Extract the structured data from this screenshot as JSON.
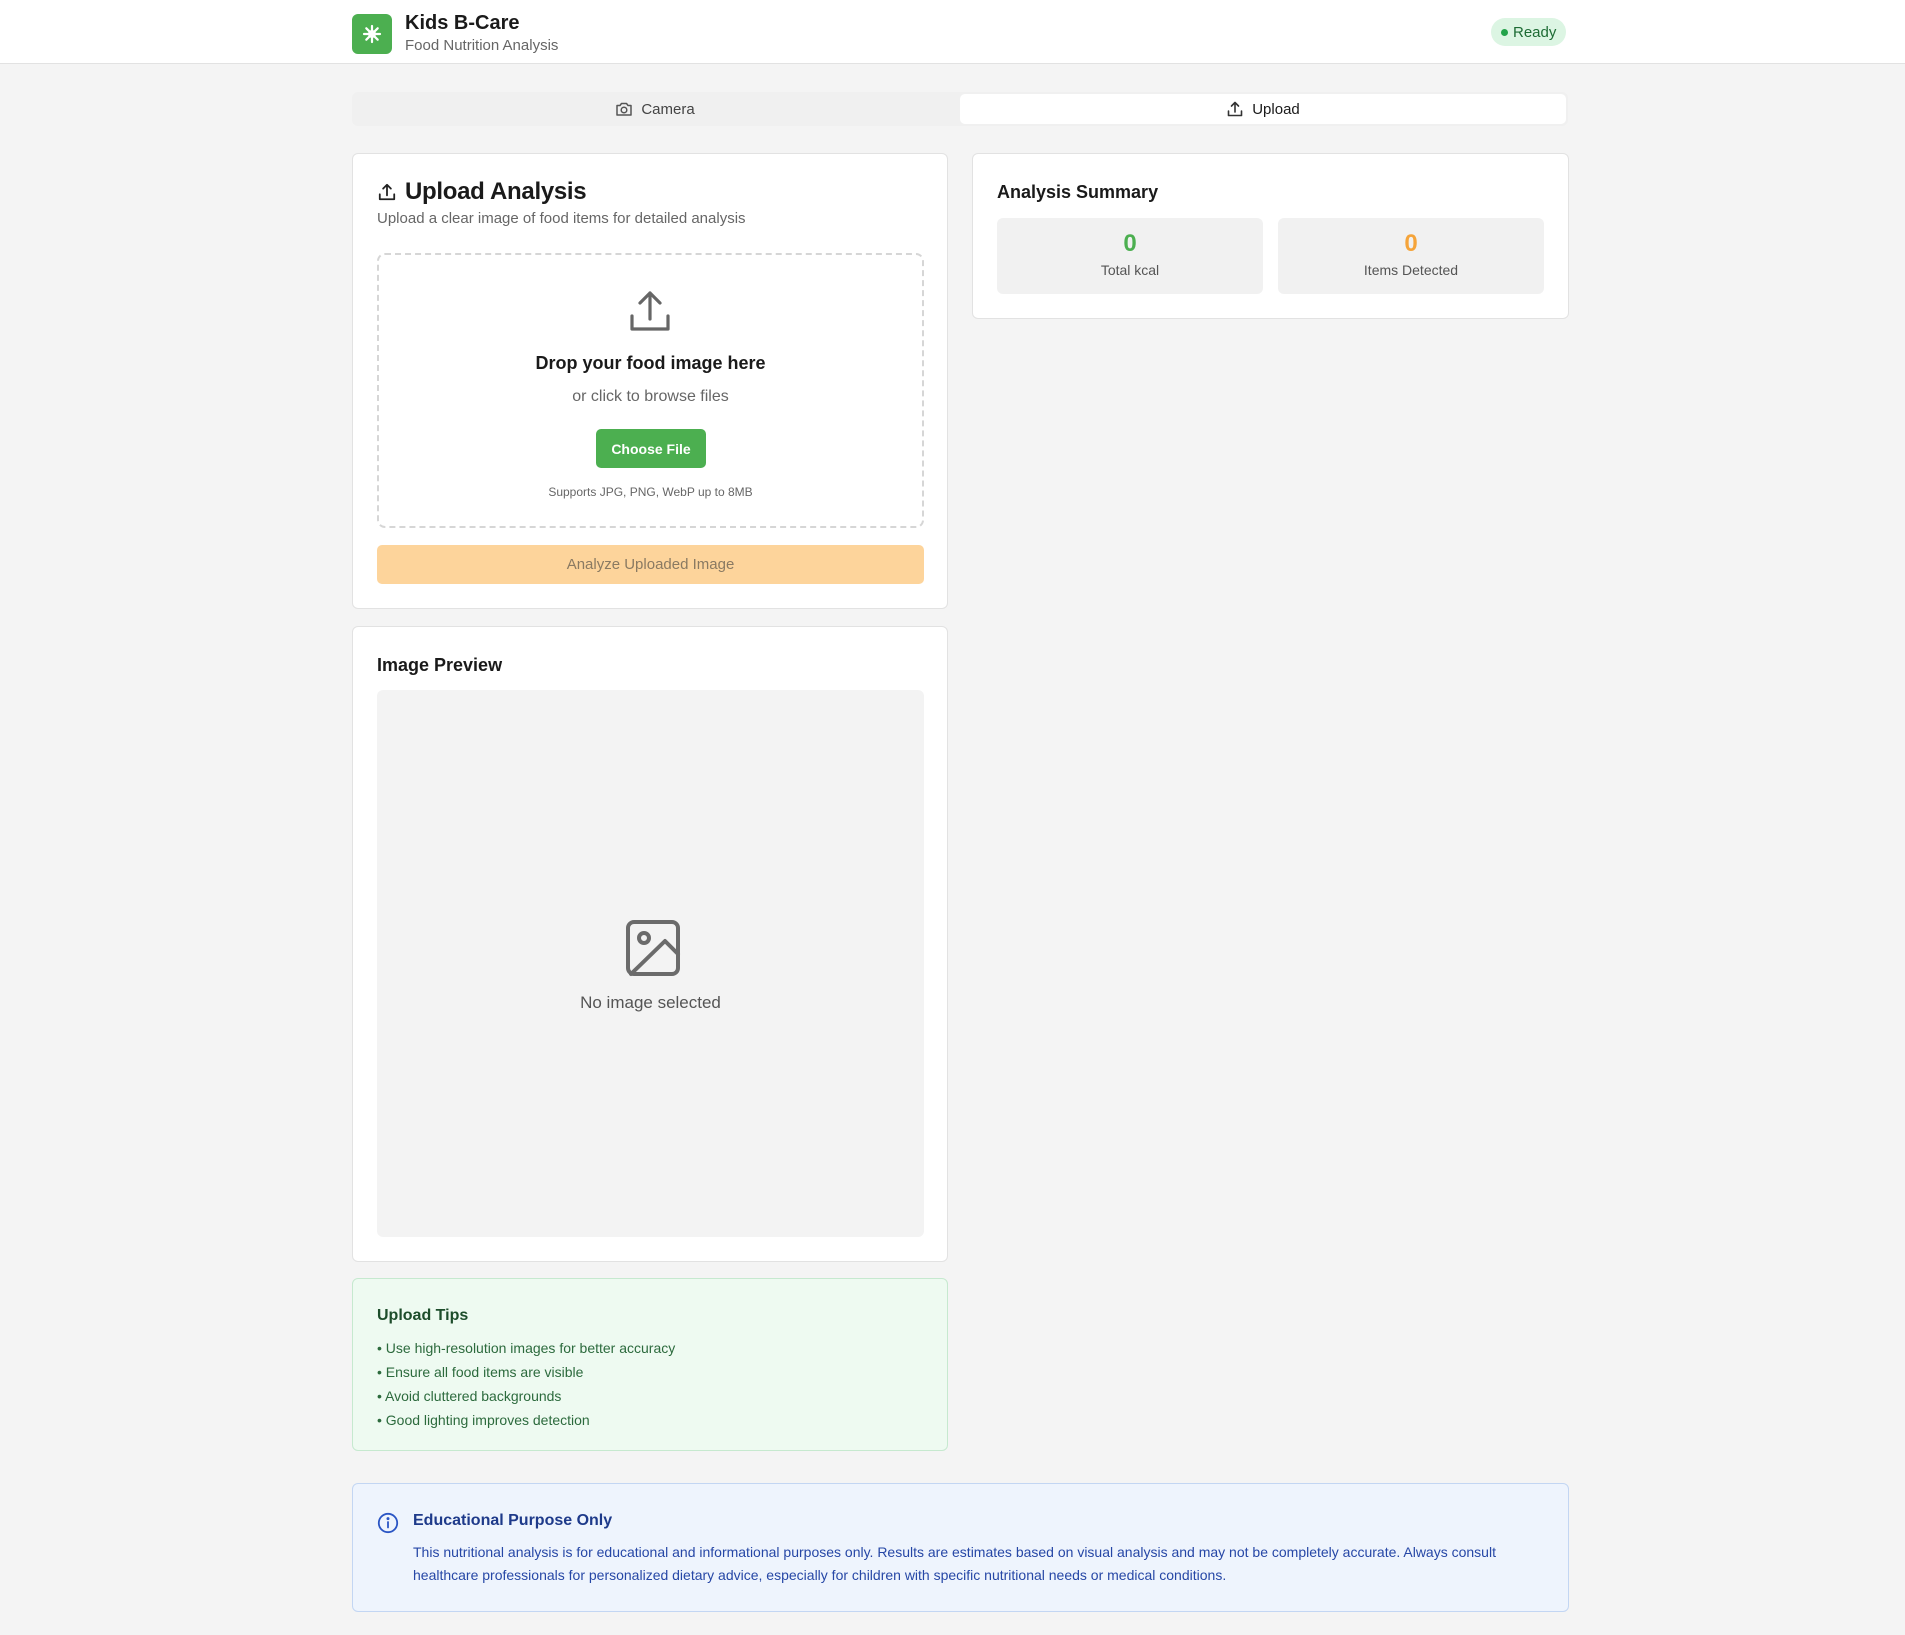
{
  "header": {
    "title": "Kids B-Care",
    "subtitle": "Food Nutrition Analysis",
    "status": "Ready"
  },
  "tabs": [
    {
      "label": "Camera",
      "icon": "camera-icon",
      "active": false
    },
    {
      "label": "Upload",
      "icon": "upload-icon",
      "active": true
    }
  ],
  "upload": {
    "title": "Upload Analysis",
    "description": "Upload a clear image of food items for detailed analysis",
    "drop_title": "Drop your food image here",
    "drop_sub": "or click to browse files",
    "choose_label": "Choose File",
    "hint": "Supports JPG, PNG, WebP up to 8MB",
    "analyze_label": "Analyze Uploaded Image"
  },
  "summary": {
    "title": "Analysis Summary",
    "stats": [
      {
        "value": "0",
        "label": "Total kcal",
        "color": "#4caf50"
      },
      {
        "value": "0",
        "label": "Items Detected",
        "color": "#f5a43a"
      }
    ]
  },
  "preview": {
    "title": "Image Preview",
    "empty": "No image selected"
  },
  "tips": {
    "title": "Upload Tips",
    "items": [
      "• Use high-resolution images for better accuracy",
      "• Ensure all food items are visible",
      "• Avoid cluttered backgrounds",
      "• Good lighting improves detection"
    ]
  },
  "info": {
    "title": "Educational Purpose Only",
    "text": "This nutritional analysis is for educational and informational purposes only. Results are estimates based on visual analysis and may not be completely accurate. Always consult healthcare professionals for personalized dietary advice, especially for children with specific nutritional needs or medical conditions."
  },
  "colors": {
    "brand": "#4caf50",
    "accent": "#f5a43a",
    "info": "#1e3a8a"
  }
}
